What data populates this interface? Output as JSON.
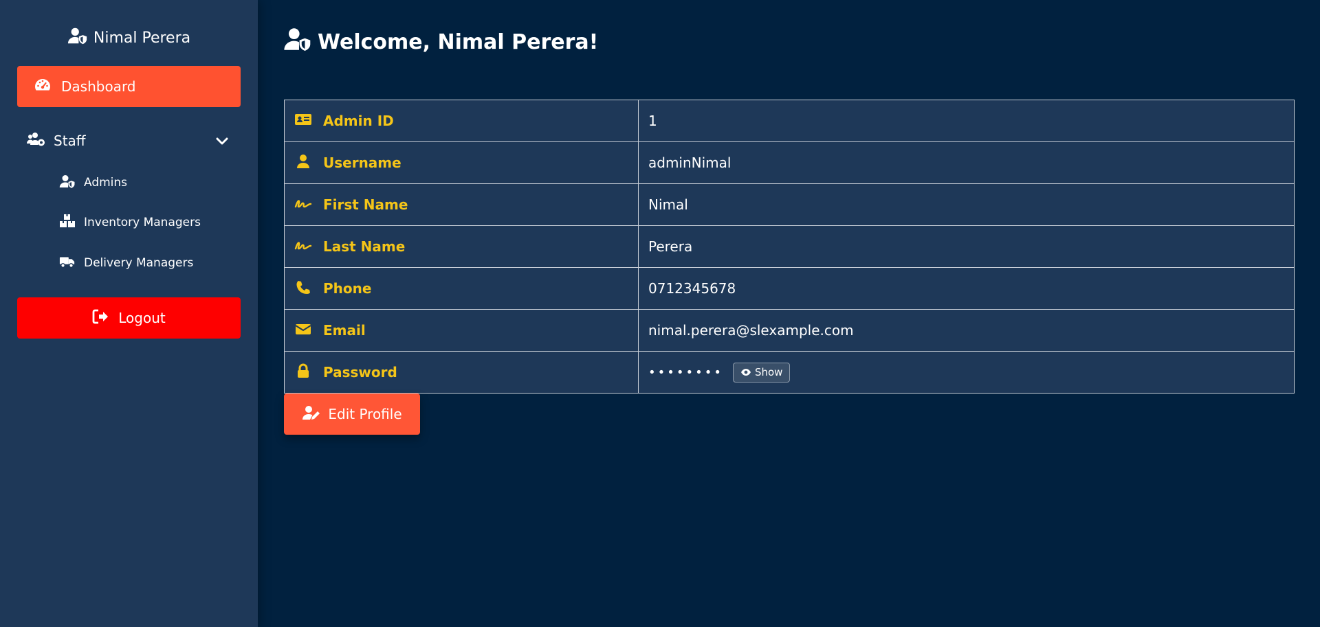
{
  "colors": {
    "background": "#01213f",
    "sidebar": "#1e3858",
    "accent": "#ff5230",
    "logout": "#fe0000",
    "label": "#f5c518"
  },
  "sidebar": {
    "user_name": "Nimal Perera",
    "user_icon": "user-shield-icon",
    "dashboard_label": "Dashboard",
    "dashboard_icon": "gauge-icon",
    "staff": {
      "label": "Staff",
      "icon": "users-cog-icon",
      "expanded": true,
      "items": [
        {
          "label": "Admins",
          "icon": "user-shield-icon"
        },
        {
          "label": "Inventory Managers",
          "icon": "boxes-icon"
        },
        {
          "label": "Delivery Managers",
          "icon": "truck-icon"
        }
      ]
    },
    "logout_label": "Logout",
    "logout_icon": "sign-out-icon"
  },
  "main": {
    "title": "Welcome, Nimal Perera!",
    "profile_rows": [
      {
        "label": "Admin ID",
        "value": "1",
        "icon": "id-card-icon"
      },
      {
        "label": "Username",
        "value": "adminNimal",
        "icon": "user-icon"
      },
      {
        "label": "First Name",
        "value": "Nimal",
        "icon": "signature-icon"
      },
      {
        "label": "Last Name",
        "value": "Perera",
        "icon": "signature-icon"
      },
      {
        "label": "Phone",
        "value": "0712345678",
        "icon": "phone-icon"
      },
      {
        "label": "Email",
        "value": "nimal.perera@slexample.com",
        "icon": "envelope-icon"
      },
      {
        "label": "Password",
        "value": "••••••••",
        "icon": "lock-icon",
        "show_label": "Show"
      }
    ],
    "edit_label": "Edit Profile",
    "edit_icon": "user-edit-icon"
  }
}
